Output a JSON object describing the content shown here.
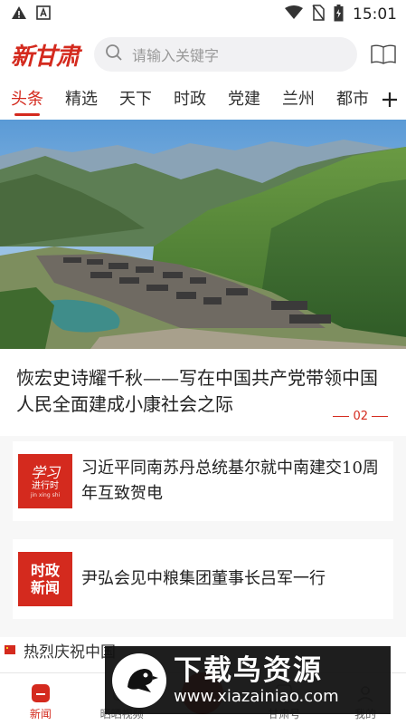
{
  "status_bar": {
    "time": "15:01",
    "icons": [
      "warning-icon",
      "font-a-icon",
      "wifi-icon",
      "no-sim-icon",
      "battery-icon"
    ]
  },
  "header": {
    "logo_text": "新甘肃",
    "search_placeholder": "请输入关键字",
    "read_paper_label": "读报"
  },
  "tabs": {
    "items": [
      "头条",
      "精选",
      "天下",
      "时政",
      "党建",
      "兰州",
      "都市"
    ],
    "active_index": 0
  },
  "headline": {
    "title": "恢宏史诗耀千秋——写在中国共产党带领中国人民全面建成小康社会之际",
    "page_number": "02"
  },
  "news_list": [
    {
      "thumb_lines": [
        "学习",
        "进行时",
        "jin xing shi"
      ],
      "title": "习近平同南苏丹总统基尔就中南建交10周年互致贺电"
    },
    {
      "thumb_lines": [
        "时政",
        "新闻"
      ],
      "title": "尹弘会见中粮集团董事长吕军一行"
    }
  ],
  "ticker": {
    "text": "热烈庆祝中国"
  },
  "bottom_nav": {
    "items": [
      {
        "label": "新闻",
        "icon": "news-icon"
      },
      {
        "label": "晒晒视频",
        "icon": "video-icon"
      },
      {
        "label": "",
        "icon": "center-action-icon"
      },
      {
        "label": "甘肃号",
        "icon": "account-icon"
      },
      {
        "label": "我的",
        "icon": "profile-icon"
      }
    ],
    "active_index": 0
  },
  "watermark": {
    "title": "下载鸟资源",
    "url": "www.xiazainiao.com"
  },
  "colors": {
    "accent": "#d42a1e",
    "search_bg": "#f1f1f3"
  }
}
